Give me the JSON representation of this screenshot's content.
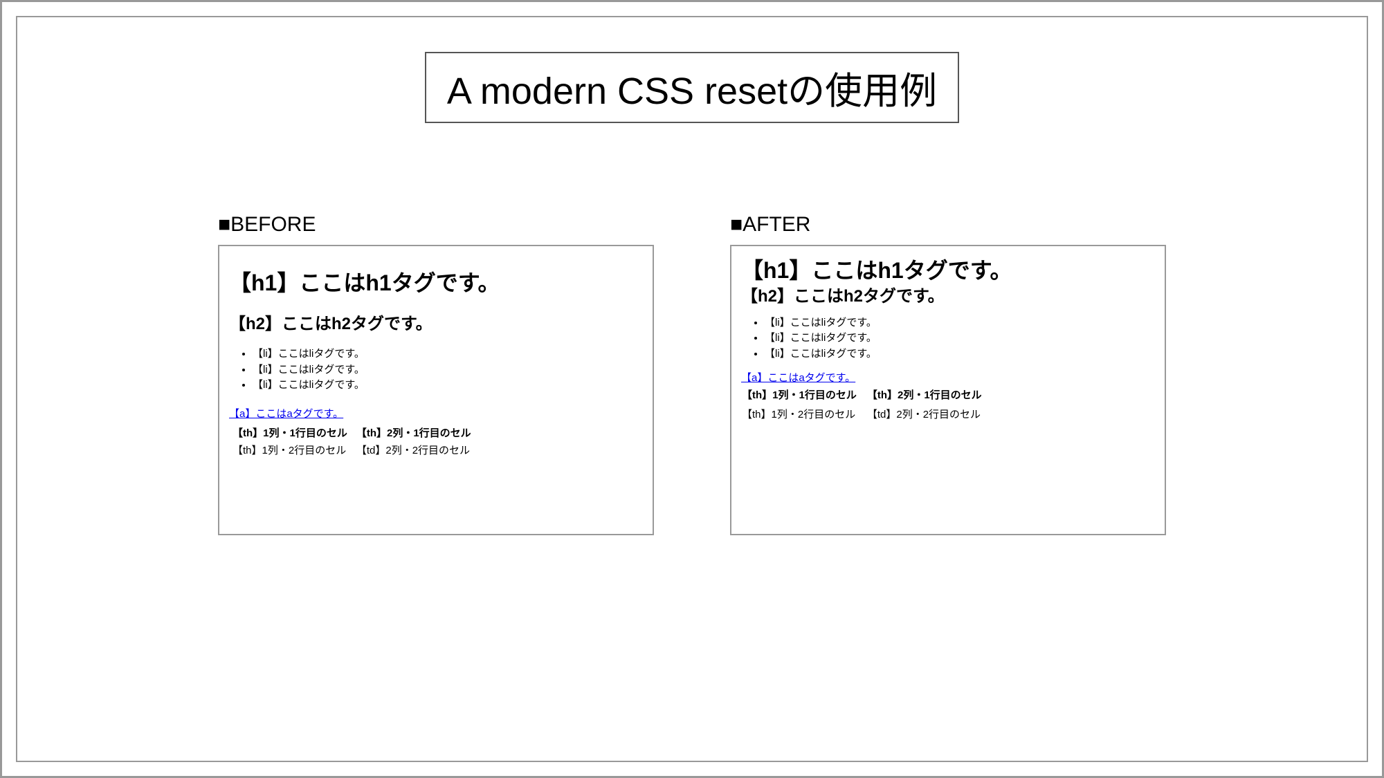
{
  "title": "A modern CSS resetの使用例",
  "before": {
    "label": "■BEFORE",
    "h1": "【h1】ここはh1タグです。",
    "h2": "【h2】ここはh2タグです。",
    "li1": "【li】ここはliタグです。",
    "li2": "【li】ここはliタグです。",
    "li3": "【li】ここはliタグです。",
    "a": "【a】ここはaタグです。",
    "th1": "【th】1列・1行目のセル",
    "th2": "【th】2列・1行目のセル",
    "td1": "【th】1列・2行目のセル",
    "td2": "【td】2列・2行目のセル"
  },
  "after": {
    "label": "■AFTER",
    "h1": "【h1】ここはh1タグです。",
    "h2": "【h2】ここはh2タグです。",
    "li1": "【li】ここはliタグです。",
    "li2": "【li】ここはliタグです。",
    "li3": "【li】ここはliタグです。",
    "a": "【a】ここはaタグです。",
    "th1": "【th】1列・1行目のセル",
    "th2": "【th】2列・1行目のセル",
    "td1": "【th】1列・2行目のセル",
    "td2": "【td】2列・2行目のセル"
  }
}
